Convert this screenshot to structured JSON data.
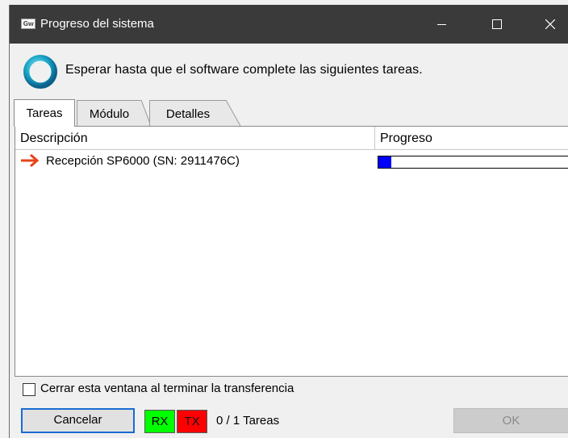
{
  "window": {
    "title": "Progreso del sistema",
    "app_logo_text": "Gw"
  },
  "message": "Esperar hasta que el software complete las siguientes tareas.",
  "tabs": [
    {
      "label": "Tareas",
      "active": true
    },
    {
      "label": "Módulo",
      "active": false
    },
    {
      "label": "Detalles",
      "active": false
    }
  ],
  "table": {
    "columns": [
      "Descripción",
      "Progreso"
    ],
    "rows": [
      {
        "description": "Recepción SP6000 (SN: 2911476C)",
        "progress_fraction": 0.07,
        "icon": "right-arrow-icon"
      }
    ]
  },
  "footer": {
    "close_on_finish_label": "Cerrar esta ventana al terminar la transferencia",
    "close_on_finish_checked": false,
    "cancel_label": "Cancelar",
    "rx_label": "RX",
    "tx_label": "TX",
    "task_count": "0 / 1 Tareas",
    "ok_label": "OK"
  },
  "colors": {
    "title_bar": "#3a3a3a",
    "progress_fill": "#0000ff",
    "rx_indicator": "#00ff00",
    "tx_indicator": "#ff0000",
    "arrow": "#e8431a"
  }
}
